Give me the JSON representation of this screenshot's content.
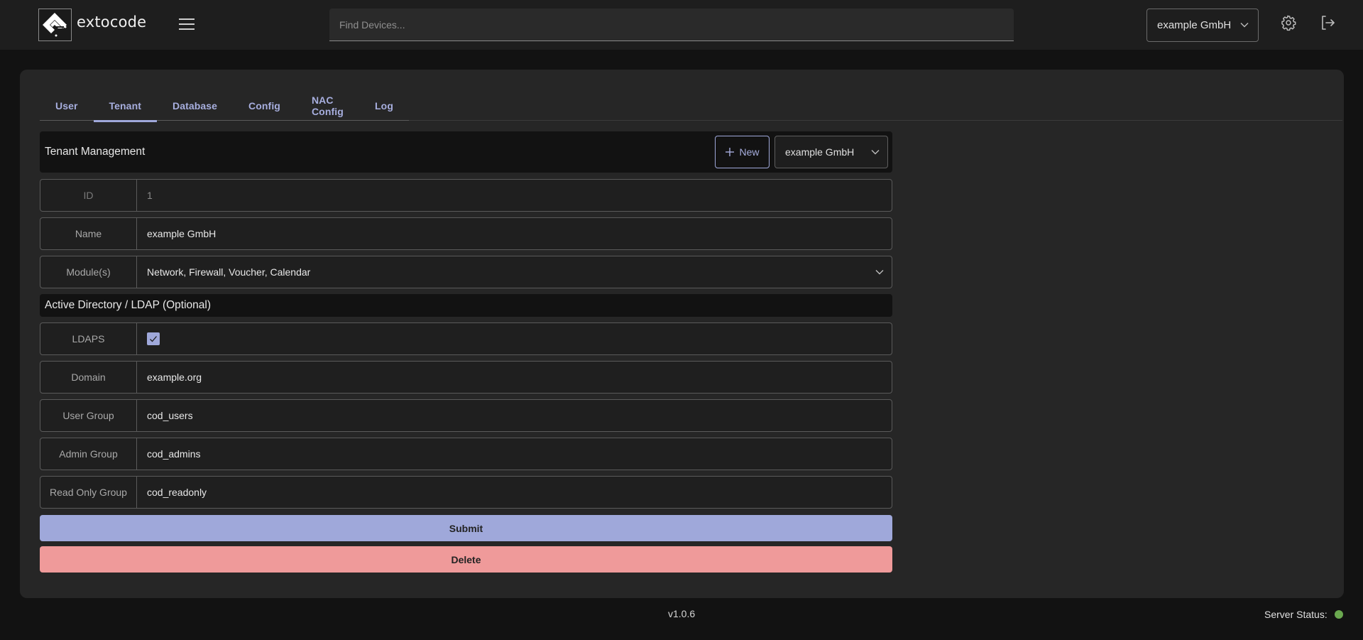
{
  "app": {
    "brand": "extocode",
    "search_placeholder": "Find Devices...",
    "tenant_selector": "example GmbH",
    "settings_icon": "gear-icon",
    "logout_icon": "logout-icon"
  },
  "tabs": [
    {
      "label": "User",
      "active": false
    },
    {
      "label": "Tenant",
      "active": true
    },
    {
      "label": "Database",
      "active": false
    },
    {
      "label": "Config",
      "active": false
    },
    {
      "label": "NAC Config",
      "active": false
    },
    {
      "label": "Log",
      "active": false
    }
  ],
  "tenant_management": {
    "title": "Tenant Management",
    "new_button": "New",
    "selected_tenant": "example GmbH",
    "fields": {
      "id": {
        "label": "ID",
        "value": "1"
      },
      "name": {
        "label": "Name",
        "value": "example GmbH"
      },
      "modules": {
        "label": "Module(s)",
        "value": "Network, Firewall, Voucher, Calendar"
      }
    }
  },
  "ldap": {
    "title": "Active Directory / LDAP (Optional)",
    "fields": {
      "ldaps": {
        "label": "LDAPS",
        "checked": true
      },
      "domain": {
        "label": "Domain",
        "value": "example.org"
      },
      "user_group": {
        "label": "User Group",
        "value": "cod_users"
      },
      "admin_group": {
        "label": "Admin Group",
        "value": "cod_admins"
      },
      "read_only_group": {
        "label": "Read Only Group",
        "value": "cod_readonly"
      }
    }
  },
  "actions": {
    "submit": "Submit",
    "delete": "Delete"
  },
  "footer": {
    "version": "v1.0.6",
    "server_status_label": "Server Status:",
    "server_status": "online",
    "status_color": "#6aa84f"
  },
  "colors": {
    "accent": "#9fa8da",
    "danger": "#ef9a9a"
  }
}
